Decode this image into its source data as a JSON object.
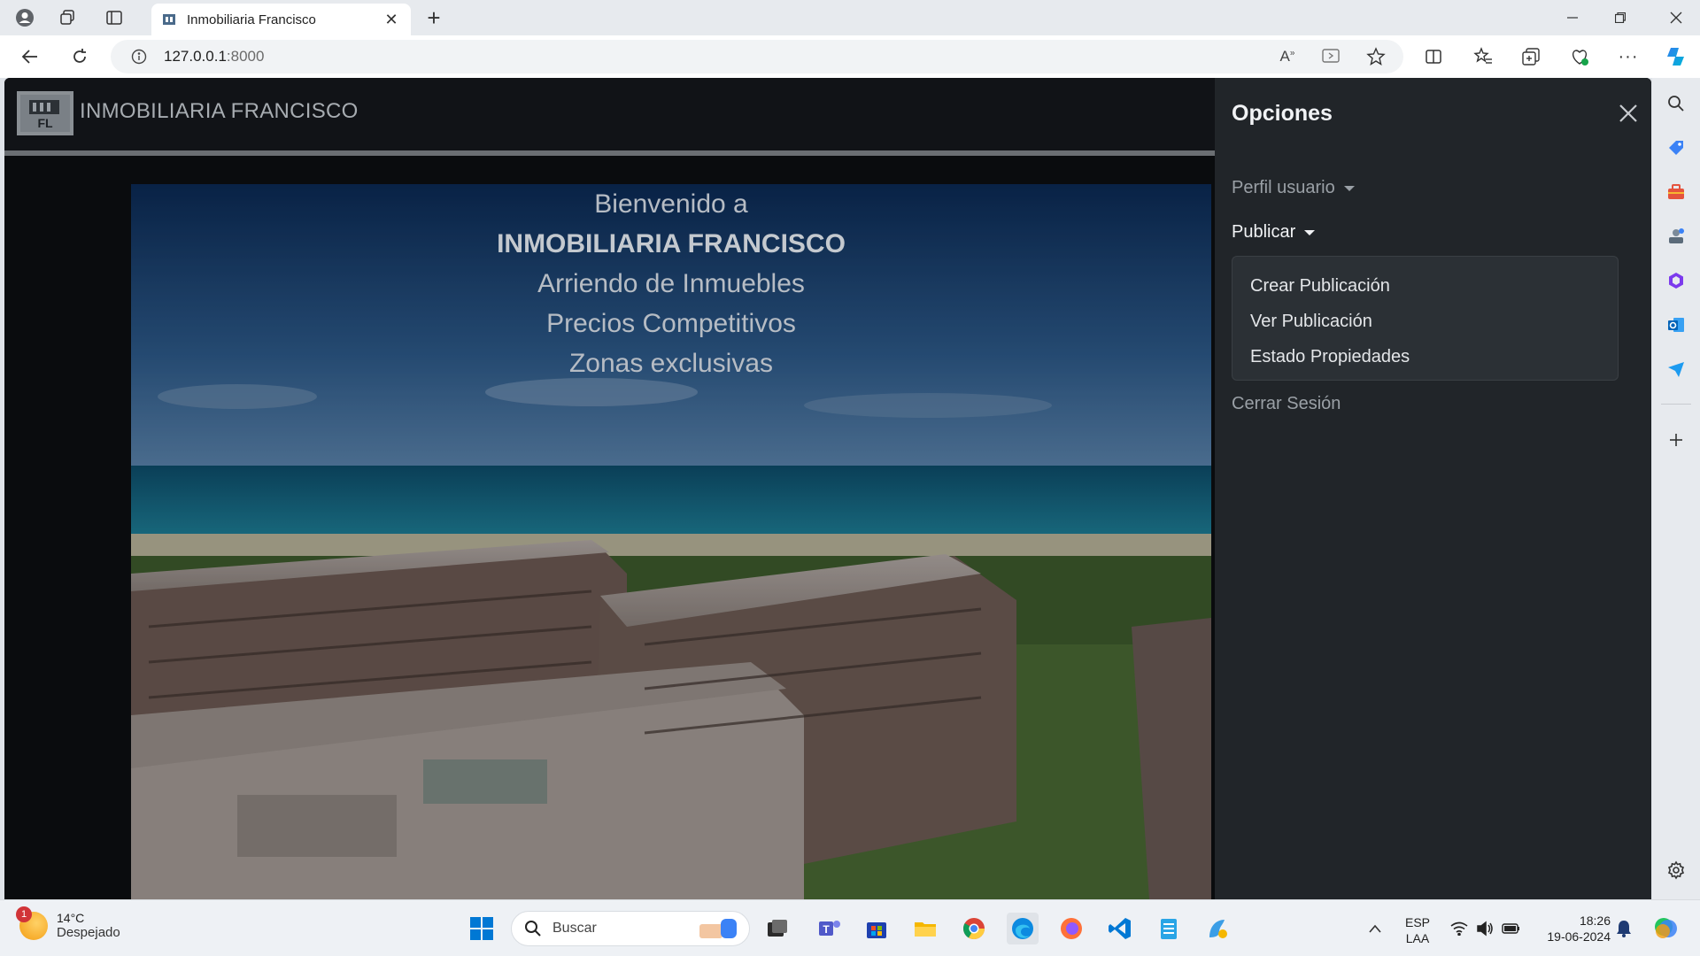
{
  "browser": {
    "tab_title": "Inmobiliaria Francisco",
    "url_host": "127.0.0.1",
    "url_port": ":8000"
  },
  "navbar": {
    "brand": "INMOBILIARIA FRANCISCO",
    "logo_text": "FL"
  },
  "hero": {
    "line1": "Bienvenido a",
    "line2": "INMOBILIARIA FRANCISCO",
    "line3": "Arriendo de Inmuebles",
    "line4": "Precios Competitivos",
    "line5": "Zonas exclusivas"
  },
  "offcanvas": {
    "title": "Opciones",
    "perfil": "Perfil usuario",
    "publicar": "Publicar",
    "dropdown_items": [
      "Crear Publicación",
      "Ver Publicación",
      "Estado Propiedades"
    ],
    "logout": "Cerrar Sesión"
  },
  "taskbar": {
    "weather_temp": "14°C",
    "weather_desc": "Despejado",
    "weather_badge": "1",
    "search_label": "Buscar",
    "lang_1": "ESP",
    "lang_2": "LAA",
    "time": "18:26",
    "date": "19-06-2024"
  },
  "colors": {
    "offcanvas_bg": "#212529",
    "navbar_bg": "#111317",
    "dropdown_bg": "#2b3035"
  }
}
